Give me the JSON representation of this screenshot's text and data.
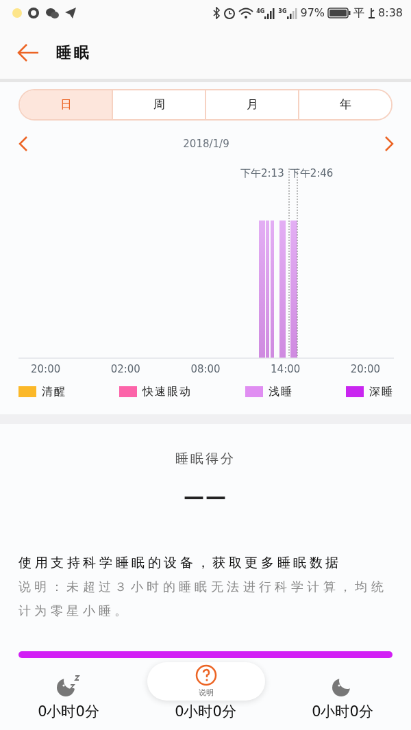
{
  "status_bar": {
    "network_1": "4G",
    "network_2": "3G",
    "battery": "97%",
    "ime": "平",
    "time": "8:38"
  },
  "header": {
    "title": "睡眠"
  },
  "tabs": [
    {
      "label": "日",
      "selected": true
    },
    {
      "label": "周",
      "selected": false
    },
    {
      "label": "月",
      "selected": false
    },
    {
      "label": "年",
      "selected": false
    }
  ],
  "date": "2018/1/9",
  "chart": {
    "markers": [
      "下午2:13",
      "下午2:46"
    ],
    "x_ticks": [
      "20:00",
      "02:00",
      "08:00",
      "14:00",
      "20:00"
    ],
    "legend": [
      {
        "label": "清醒",
        "color": "#fbb829"
      },
      {
        "label": "快速眼动",
        "color": "#fc64a9"
      },
      {
        "label": "浅睡",
        "color": "#e08ef2"
      },
      {
        "label": "深睡",
        "color": "#c926f0"
      }
    ]
  },
  "score": {
    "title": "睡眠得分",
    "value": "——"
  },
  "notice": {
    "heading": "使用支持科学睡眠的设备，获取更多睡眠数据",
    "description": "说明：未超过３小时的睡眠无法进行科学计算，均统计为零星小睡。"
  },
  "stage_bar": {
    "level": 1
  },
  "summary": [
    {
      "kind": "snooze",
      "value": "0小时0分"
    },
    {
      "kind": "covered",
      "value": "0小时0分"
    },
    {
      "kind": "moon",
      "value": "0小时0分"
    }
  ],
  "help_button": {
    "label": "说明"
  }
}
